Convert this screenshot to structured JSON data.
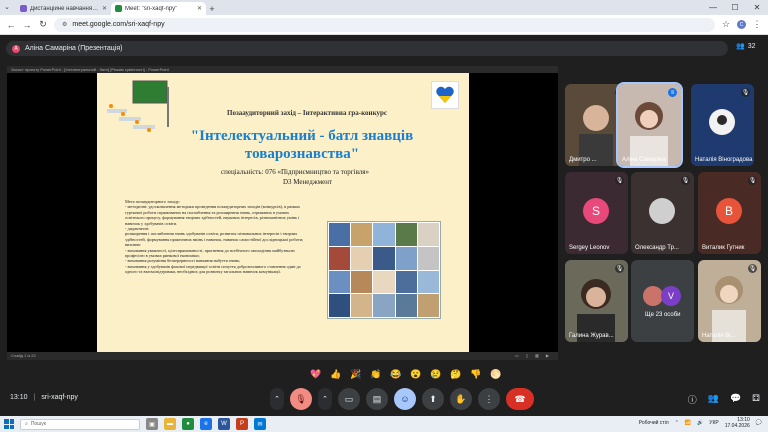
{
  "browser": {
    "tabs": [
      {
        "title": "Дистанційне навчання в ВСП",
        "favicon_color": "#7a5cc7",
        "active": false
      },
      {
        "title": "Meet: \"sri-xaqf-npy\"",
        "favicon_color": "#1e8e3e",
        "active": true
      }
    ],
    "url": "meet.google.com/sri-xaqf-npy",
    "profile_initial": "С"
  },
  "meet": {
    "presenter_label": "Аліна Самаріна (Презентація)",
    "presenter_initial": "А",
    "participant_count": "32",
    "meeting_time": "13:10",
    "meeting_code": "sri-xaqf-npy"
  },
  "ppt": {
    "titlebar": "Захист проєкту PowerPoint - [Інтелектуальний - батл] [Режим сумісності] - PowerPoint",
    "status_left": "Слайд 1 із 22"
  },
  "slide": {
    "subtitle": "Позааудиторний захід – Інтерактивна гра-конкурс",
    "title_line1": "\"Інтелектуальний - батл знавців",
    "title_line2": "товарознавства\"",
    "specialty": "спеціальність: 076 «Підприємництво та торгівля»",
    "program": "D3 Менеджмент",
    "goals": [
      "Мета позааудиторного заходу:",
      "- методичні: удосконалення методики проведення позааудиторних заходів (конкурсів), в рамках гурткової роботи спрямованих на поглиблення та розширення знань, отриманих в умовах освітнього процесу, формування творчих здібностей, наукових інтересів, різноманітних умінь і навичок у здобувачів освіти.",
      "- дидактичні:",
      "розширення і поглиблення знань здобувачів освіти, розвиток пізнавальних інтересів і творчих здібностей, формування практичних вмінь і навичок, навичок самостійної дослідницької роботи;",
      "виховна:",
      "- виховання уважності, цілеспрямованості, прагнення до всебічного оволодіння майбутньою професією в умовах ринкової економіки;",
      "- виховання розуміння безперервності навчання набуття знань;",
      "- виховання у здобувачів фахової передвищої освіти почуття доброзичливого ставлення один до одного та взаємопідтримки, необхідних для розвитку загальних навичок комунікації."
    ]
  },
  "participants": [
    {
      "name": "Дмитро ...",
      "initial": "",
      "avatar_color": "#5a4a3a",
      "muted": true
    },
    {
      "name": "Аліна Самаріна",
      "initial": "",
      "avatar_color": "#c7b8b0",
      "muted": false,
      "speaking": true
    },
    {
      "name": "Наталія Віноградова",
      "initial": "",
      "avatar_color": "#1e3a6e",
      "muted": true
    },
    {
      "name": "Sergey Leonov",
      "initial": "S",
      "avatar_color": "#e8497a",
      "muted": true
    },
    {
      "name": "Олександр Тр...",
      "initial": "",
      "avatar_color": "#cfcfcf",
      "muted": true
    },
    {
      "name": "Виталик Гутник",
      "initial": "В",
      "avatar_color": "#e8543a",
      "muted": true
    },
    {
      "name": "Галина Журав...",
      "initial": "",
      "avatar_color": "#6b6a5a",
      "muted": true
    },
    {
      "name": "Ще 23 особи",
      "initial": "V",
      "avatar_color": "#7b3fc7",
      "muted": false
    },
    {
      "name": "Наталія Ві...",
      "initial": "",
      "avatar_color": "#bfae98",
      "muted": true
    }
  ],
  "reactions": [
    "💖",
    "👍",
    "🎉",
    "👏",
    "😂",
    "😮",
    "😢",
    "🤔",
    "👎",
    "🌕"
  ],
  "taskbar": {
    "search_placeholder": "Пошук",
    "desktop_label": "Робочий стіл",
    "language": "УКР",
    "time": "13:10",
    "date": "17.04.2026"
  }
}
